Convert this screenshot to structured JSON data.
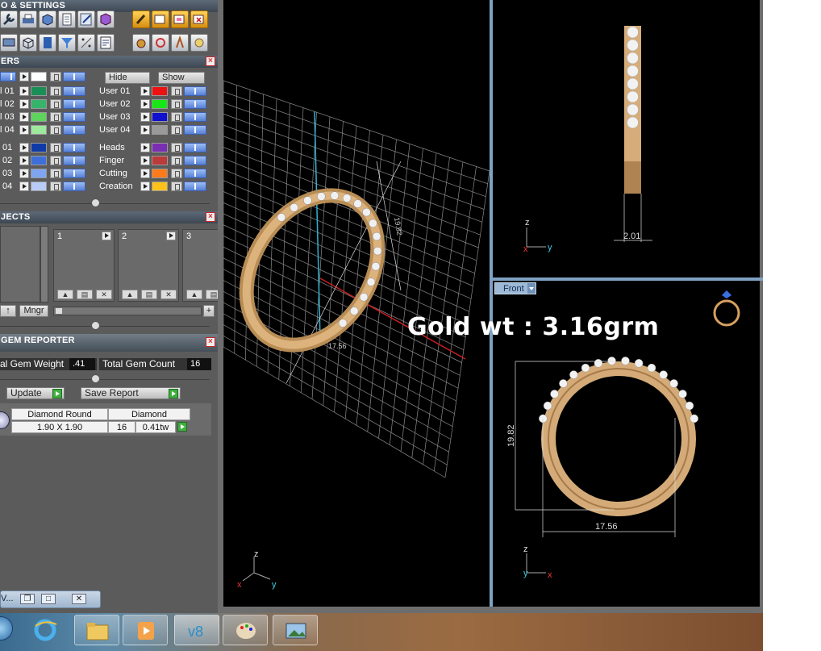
{
  "left_panel": {
    "toolbar_header": "O & SETTINGS",
    "layers_header": "ERS",
    "objects_header": "JECTS",
    "gem_header": "GEM REPORTER",
    "hide_label": "Hide",
    "show_label": "Show",
    "layers_left": [
      {
        "name": "l 01",
        "color": "#1a8f55"
      },
      {
        "name": "l 02",
        "color": "#36b46a"
      },
      {
        "name": "l 03",
        "color": "#5ed35e"
      },
      {
        "name": "l 04",
        "color": "#9ee89e"
      }
    ],
    "layers_left_blue": [
      {
        "name": "01",
        "color": "#0f3aa8"
      },
      {
        "name": "02",
        "color": "#3e6fd8"
      },
      {
        "name": "03",
        "color": "#7fa5f0"
      },
      {
        "name": "04",
        "color": "#b9ccf7"
      }
    ],
    "layers_right_user": [
      {
        "name": "User 01",
        "color": "#ee1111"
      },
      {
        "name": "User 02",
        "color": "#17e717"
      },
      {
        "name": "User 03",
        "color": "#1010d0"
      },
      {
        "name": "User 04",
        "color": "#9a9a9a"
      }
    ],
    "layers_right_named": [
      {
        "name": "Heads",
        "color": "#7a2fb3"
      },
      {
        "name": "Finger",
        "color": "#bb3a3a"
      },
      {
        "name": "Cutting",
        "color": "#ff7a1a"
      },
      {
        "name": "Creation",
        "color": "#ffc21a"
      }
    ],
    "object_slots": [
      "1",
      "2",
      "3"
    ],
    "mngr_label": "Mngr",
    "gem": {
      "weight_label": "al Gem Weight",
      "weight_value": ".41",
      "count_label": "Total Gem Count",
      "count_value": "16",
      "update_label": "Update",
      "save_label": "Save Report",
      "table_headers": [
        "Diamond Round",
        "Diamond"
      ],
      "row": {
        "size": "1.90 X 1.90",
        "count": "16",
        "weight": "0.41tw"
      }
    }
  },
  "viewports": {
    "front_label": "Front",
    "overlay_text": "Gold wt : 3.16grm",
    "dims": {
      "height": "19.82",
      "width": "17.56",
      "thickness": "2.01"
    },
    "axes": {
      "x": "x",
      "y": "y",
      "z": "z"
    }
  },
  "mini_window": {
    "label": "V..."
  }
}
